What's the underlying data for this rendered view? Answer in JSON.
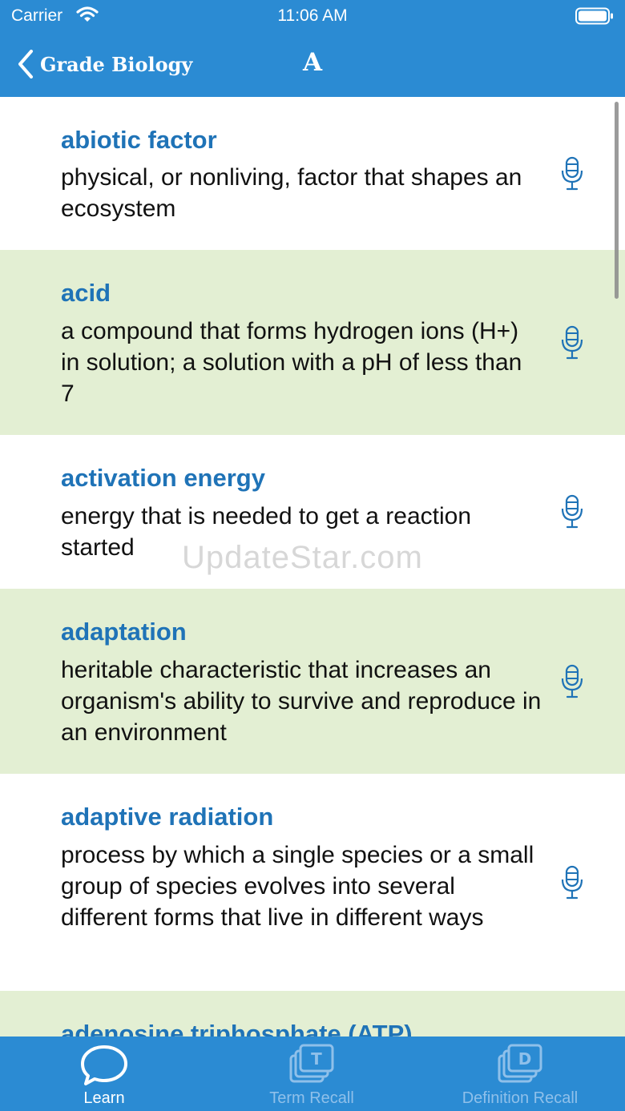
{
  "status_bar": {
    "carrier": "Carrier",
    "time": "11:06 AM"
  },
  "nav": {
    "back_label": "Grade Biology",
    "title": "A"
  },
  "entries": [
    {
      "term": "abiotic factor",
      "definition": "physical, or nonliving, factor that shapes an ecosystem"
    },
    {
      "term": "acid",
      "definition": "a compound that forms hydrogen ions (H+) in solution; a solution with a pH of less than 7"
    },
    {
      "term": "activation energy",
      "definition": "energy that is needed to get a reaction started"
    },
    {
      "term": "adaptation",
      "definition": "heritable characteristic that increases an organism's ability to survive and reproduce in an environment"
    },
    {
      "term": "adaptive radiation",
      "definition": "process by which a single species or a small group of species evolves into several different forms that live in different ways"
    },
    {
      "term": "adenosine triphosphate (ATP)",
      "definition": ""
    }
  ],
  "watermark": "UpdateStar.com",
  "tabs": [
    {
      "label": "Learn",
      "icon": "speech-bubble-icon",
      "active": true
    },
    {
      "label": "Term Recall",
      "icon": "stacked-cards-t-icon",
      "active": false
    },
    {
      "label": "Definition Recall",
      "icon": "stacked-cards-d-icon",
      "active": false
    }
  ],
  "colors": {
    "header": "#2b8bd3",
    "term": "#1f73b7",
    "alt_row": "#e3efd3",
    "inactive_tab": "#8fc0ea"
  }
}
